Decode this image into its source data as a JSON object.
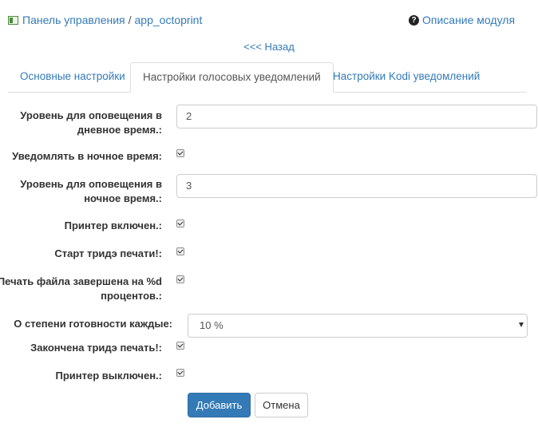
{
  "breadcrumb": {
    "root_label": "Панель управления",
    "separator": "/",
    "module": "app_octoprint"
  },
  "help_link": "Описание модуля",
  "back_link": "<<< Назад",
  "tabs": [
    {
      "label": "Основные настройки",
      "active": false
    },
    {
      "label": "Настройки голосовых уведомлений",
      "active": true
    },
    {
      "label": "Настройки Kodi уведомлений",
      "active": false
    }
  ],
  "form": {
    "day_level_label": "Уровень для оповещения в дневное время.:",
    "day_level_value": "2",
    "notify_night_label": "Уведомлять в ночное время:",
    "notify_night_checked": true,
    "night_level_label": "Уровень для оповещения в ночное время.:",
    "night_level_value": "3",
    "printer_on_label": "Принтер включен.:",
    "printer_on_checked": true,
    "print_start_label": "Старт тридэ печати!:",
    "print_start_checked": true,
    "file_done_label": "Печать файла завершена на %d процентов.:",
    "file_done_checked": true,
    "progress_every_label": "О степени готовности каждые:",
    "progress_every_value": "10 %",
    "print_done_label": "Закончена тридэ печать!:",
    "print_done_checked": true,
    "printer_off_label": "Принтер выключен.:",
    "printer_off_checked": true
  },
  "buttons": {
    "submit": "Добавить",
    "cancel": "Отмена"
  },
  "colors": {
    "link": "#337ab7",
    "primary": "#337ab7",
    "border": "#dddddd"
  }
}
